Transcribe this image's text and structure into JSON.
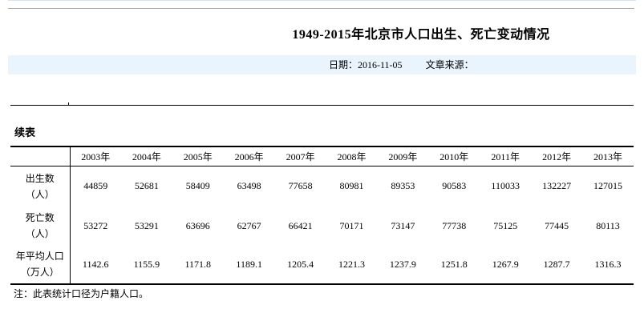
{
  "page": {
    "title": "1949-2015年北京市人口出生、死亡变动情况",
    "meta": {
      "date_label": "日期：2016-11-05",
      "source_label": "文章来源："
    },
    "continued_label": "续表",
    "footnote": "注：此表统计口径为户籍人口。"
  },
  "colors": {
    "meta_bar_bg": "#e9f4fd",
    "top_divider_gray": "#a6a6a6",
    "table_border": "#000000"
  },
  "table": {
    "columns": [
      "2003年",
      "2004年",
      "2005年",
      "2006年",
      "2007年",
      "2008年",
      "2009年",
      "2010年",
      "2011年",
      "2012年",
      "2013年"
    ],
    "rows": [
      {
        "label_line1": "出生数",
        "label_line2": "（人）",
        "values": [
          "44859",
          "52681",
          "58409",
          "63498",
          "77658",
          "80981",
          "89353",
          "90583",
          "110033",
          "132227",
          "127015"
        ]
      },
      {
        "label_line1": "死亡数",
        "label_line2": "（人）",
        "values": [
          "53272",
          "53291",
          "63696",
          "62767",
          "66421",
          "70171",
          "73147",
          "77738",
          "75125",
          "77445",
          "80113"
        ]
      },
      {
        "label_line1": "年平均人口",
        "label_line2": "（万人）",
        "values": [
          "1142.6",
          "1155.9",
          "1171.8",
          "1189.1",
          "1205.4",
          "1221.3",
          "1237.9",
          "1251.8",
          "1267.9",
          "1287.7",
          "1316.3"
        ]
      }
    ]
  }
}
